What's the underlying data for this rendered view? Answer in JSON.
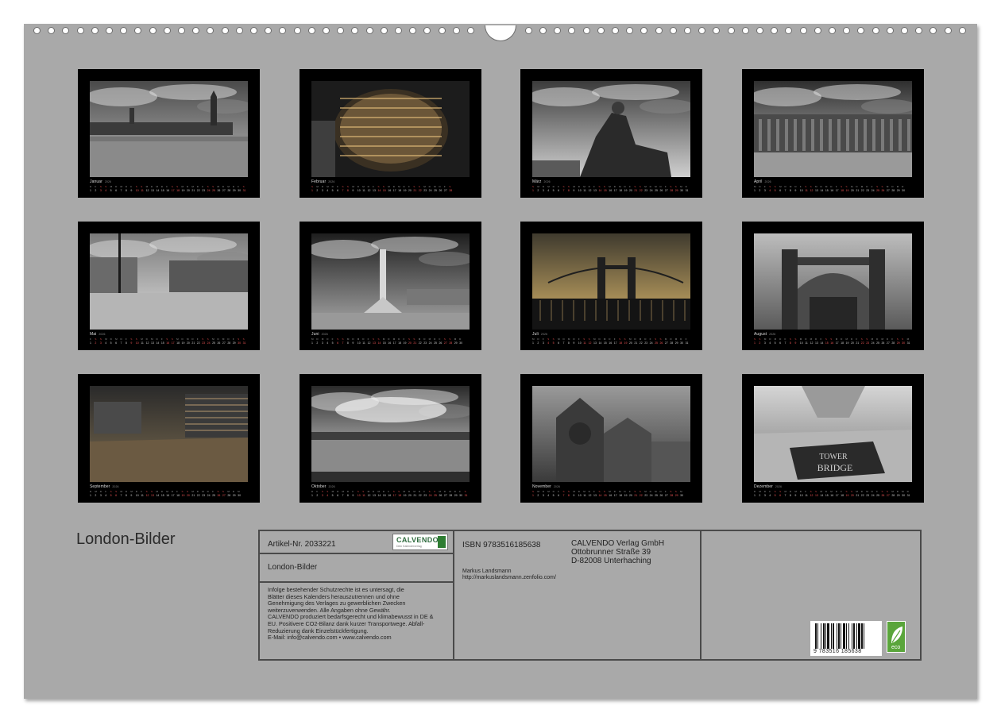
{
  "calendar": {
    "year": "2026",
    "months": [
      {
        "name": "Januar",
        "first_weekday": 3,
        "days": 31
      },
      {
        "name": "Februar",
        "first_weekday": 6,
        "days": 28
      },
      {
        "name": "März",
        "first_weekday": 6,
        "days": 31
      },
      {
        "name": "April",
        "first_weekday": 2,
        "days": 30
      },
      {
        "name": "Mai",
        "first_weekday": 4,
        "days": 31
      },
      {
        "name": "Juni",
        "first_weekday": 0,
        "days": 30
      },
      {
        "name": "Juli",
        "first_weekday": 2,
        "days": 31
      },
      {
        "name": "August",
        "first_weekday": 5,
        "days": 31
      },
      {
        "name": "September",
        "first_weekday": 1,
        "days": 30
      },
      {
        "name": "Oktober",
        "first_weekday": 3,
        "days": 31
      },
      {
        "name": "November",
        "first_weekday": 6,
        "days": 30
      },
      {
        "name": "Dezember",
        "first_weekday": 1,
        "days": 31
      }
    ]
  },
  "cover": {
    "title": "London-Bilder"
  },
  "info": {
    "article": "Artikel-Nr. 2033221",
    "title": "London-Bilder",
    "legal": [
      "Infolge bestehender Schutzrechte ist es untersagt, die",
      "Blätter dieses Kalenders herauszutrennen und ohne",
      "Genehmigung des Verlages zu gewerblichen Zwecken",
      "weiterzuverwenden. Alle Angaben ohne Gewähr.",
      "CALVENDO produziert bedarfsgerecht und klimabewusst in DE &",
      "EU. Positivere CO2-Bilanz dank kurzer Transportwege. Abfall-",
      "Reduzierung dank Einzelstückfertigung.",
      "E-Mail: info@calvendo.com • www.calvendo.com"
    ],
    "isbn": "ISBN 9783516185638",
    "publisher": [
      "CALVENDO Verlag GmbH",
      "Ottobrunner Straße 39",
      "D-82008 Unterhaching"
    ],
    "author": "Markus Landsmann",
    "author_url": "http://markuslandsmann.zenfolio.com/",
    "logo_text": "CALVENDO",
    "logo_sub": "Dein Kalenderverlag",
    "barcode_digits": "9 783516 185638",
    "eco_label": "eco"
  }
}
